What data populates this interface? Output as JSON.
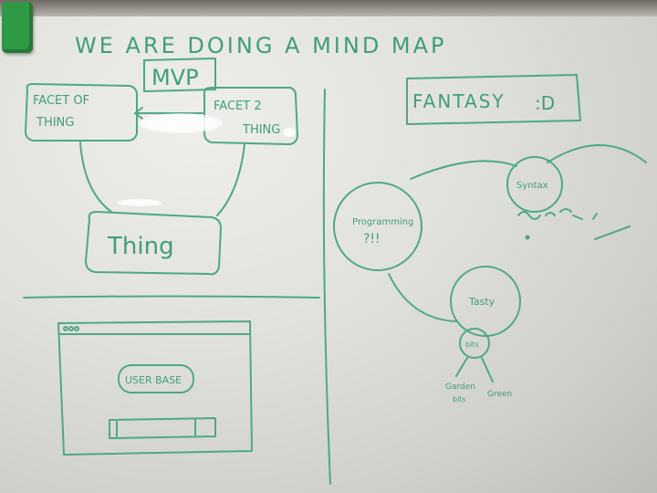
{
  "title": "WE ARE DOING A MIND MAP",
  "mvp": {
    "label": "MVP",
    "facet_left": [
      "FACET OF",
      "THING"
    ],
    "facet_right": [
      "FACET 2",
      "THING"
    ],
    "center": "Thing"
  },
  "wireframe": {
    "button_label": "USER BASE"
  },
  "fantasy": {
    "label": "FANTASY",
    "smiley": ":D"
  },
  "bubbles": {
    "programming": [
      "Programming",
      "?!!"
    ],
    "syntax": "Syntax",
    "tasty": "Tasty",
    "small_circle": "bits",
    "root_left": [
      "Garden",
      "bits"
    ],
    "root_right": "Green"
  },
  "colors": {
    "marker_green": "#4fa888",
    "eraser_green": "#2f9a45"
  }
}
